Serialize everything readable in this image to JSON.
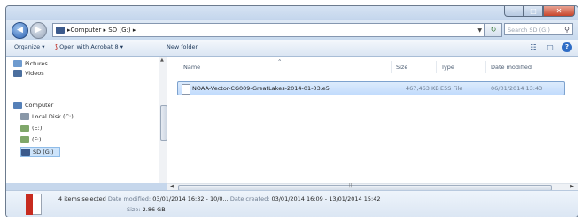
{
  "address": {
    "crumbs": [
      "Computer",
      "SD (G:)"
    ],
    "search_placeholder": "Search SD (G:)"
  },
  "toolbar": {
    "organize": "Organize",
    "open_with": "Open with Acrobat 8",
    "new_folder": "New folder"
  },
  "sidebar": {
    "items": [
      {
        "label": "Pictures"
      },
      {
        "label": "Videos"
      },
      {
        "label": "Computer"
      },
      {
        "label": "Local Disk (C:)"
      },
      {
        "label": "(E:)"
      },
      {
        "label": "(F:)"
      },
      {
        "label": "SD (G:)"
      }
    ]
  },
  "columns": {
    "name": "Name",
    "size": "Size",
    "type": "Type",
    "date": "Date modified"
  },
  "files": [
    {
      "name": "NOAA-Vector-CG009-GreatLakes-2014-01-03.e5",
      "size": "467,463 KB",
      "type": "E5S File",
      "date": "06/01/2014 13:43"
    }
  ],
  "details": {
    "selected": "4 items selected",
    "date_modified_label": "Date modified:",
    "date_modified": "03/01/2014 16:32 - 10/0...",
    "date_created_label": "Date created:",
    "date_created": "03/01/2014 16:09 - 13/01/2014 15:42",
    "size_label": "Size:",
    "size": "2.86 GB"
  },
  "colors": {
    "chrome": "#c6d7ec",
    "selection": "#cde4fb",
    "accent": "#2b62b3"
  }
}
